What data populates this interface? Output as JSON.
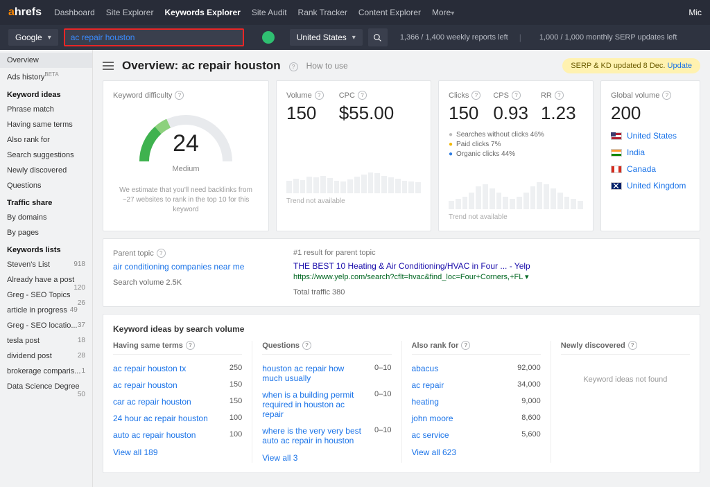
{
  "topnav": {
    "items": [
      "Dashboard",
      "Site Explorer",
      "Keywords Explorer",
      "Site Audit",
      "Rank Tracker",
      "Content Explorer",
      "More"
    ],
    "active_index": 2,
    "user": "Mic"
  },
  "searchbar": {
    "engine": "Google",
    "query": "ac repair houston",
    "country": "United States",
    "weekly": "1,366 / 1,400 weekly reports left",
    "monthly": "1,000 / 1,000 monthly SERP updates left"
  },
  "sidebar": {
    "top": [
      "Overview",
      "Ads history"
    ],
    "keyword_ideas_label": "Keyword ideas",
    "keyword_ideas": [
      "Phrase match",
      "Having same terms",
      "Also rank for",
      "Search suggestions",
      "Newly discovered",
      "Questions"
    ],
    "traffic_share_label": "Traffic share",
    "traffic_share": [
      "By domains",
      "By pages"
    ],
    "keywords_lists_label": "Keywords lists",
    "lists": [
      {
        "name": "Steven's List",
        "cnt": "918"
      },
      {
        "name": "Already have a post",
        "cnt": "120"
      },
      {
        "name": "Greg - SEO Topics",
        "cnt": "26"
      },
      {
        "name": "article in progress",
        "cnt": "49"
      },
      {
        "name": "Greg - SEO locatio...",
        "cnt": "37"
      },
      {
        "name": "tesla post",
        "cnt": "18"
      },
      {
        "name": "dividend post",
        "cnt": "28"
      },
      {
        "name": "brokerage comparis...",
        "cnt": "1"
      },
      {
        "name": "Data Science Degree",
        "cnt": "50"
      }
    ]
  },
  "page": {
    "title": "Overview: ac repair houston",
    "how_to_use": "How to use",
    "serp_pill_prefix": "SERP & KD updated 8 Dec.",
    "serp_pill_action": "Update"
  },
  "metrics": {
    "kd_label": "Keyword difficulty",
    "kd_value": "24",
    "kd_level": "Medium",
    "kd_estimate": "We estimate that you'll need backlinks from ~27 websites to rank in the top 10 for this keyword",
    "volume_label": "Volume",
    "volume": "150",
    "cpc_label": "CPC",
    "cpc": "$55.00",
    "trend_na": "Trend not available",
    "clicks_label": "Clicks",
    "clicks": "150",
    "cps_label": "CPS",
    "cps": "0.93",
    "rr_label": "RR",
    "rr": "1.23",
    "legend": {
      "no_click": "Searches without clicks 46%",
      "paid": "Paid clicks 7%",
      "organic": "Organic clicks 44%"
    },
    "global_label": "Global volume",
    "global": "200",
    "countries": [
      "United States",
      "India",
      "Canada",
      "United Kingdom"
    ]
  },
  "parent_topic": {
    "label": "Parent topic",
    "link": "air conditioning companies near me",
    "sv": "Search volume 2.5K",
    "result_label": "#1 result for parent topic",
    "result_title": "THE BEST 10 Heating & Air Conditioning/HVAC in Four ... - Yelp",
    "result_url": "https://www.yelp.com/search?cflt=hvac&find_loc=Four+Corners,+FL",
    "traffic": "Total traffic 380"
  },
  "ideas": {
    "title": "Keyword ideas by search volume",
    "cols": {
      "same_terms": {
        "label": "Having same terms",
        "rows": [
          {
            "k": "ac repair houston tx",
            "v": "250"
          },
          {
            "k": "ac repair houston",
            "v": "150"
          },
          {
            "k": "car ac repair houston",
            "v": "150"
          },
          {
            "k": "24 hour ac repair houston",
            "v": "100"
          },
          {
            "k": "auto ac repair houston",
            "v": "100"
          }
        ],
        "viewall": "View all 189"
      },
      "questions": {
        "label": "Questions",
        "rows": [
          {
            "k": "houston ac repair how much usually",
            "v": "0–10"
          },
          {
            "k": "when is a building permit required in houston ac repair",
            "v": "0–10"
          },
          {
            "k": "where is the very very best auto ac repair in houston",
            "v": "0–10"
          }
        ],
        "viewall": "View all 3"
      },
      "also_rank": {
        "label": "Also rank for",
        "rows": [
          {
            "k": "abacus",
            "v": "92,000"
          },
          {
            "k": "ac repair",
            "v": "34,000"
          },
          {
            "k": "heating",
            "v": "9,000"
          },
          {
            "k": "john moore",
            "v": "8,600"
          },
          {
            "k": "ac service",
            "v": "5,600"
          }
        ],
        "viewall": "View all 623"
      },
      "newly": {
        "label": "Newly discovered",
        "notfound": "Keyword ideas not found"
      }
    }
  }
}
